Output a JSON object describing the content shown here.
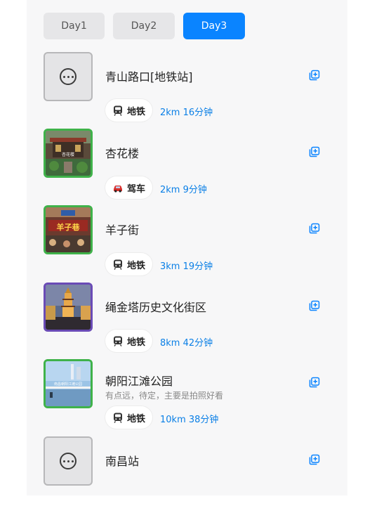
{
  "colors": {
    "accent": "#0a84ff",
    "distance_text": "#0a7fe6"
  },
  "tabs": [
    {
      "label": "Day1",
      "active": false
    },
    {
      "label": "Day2",
      "active": false
    },
    {
      "label": "Day3",
      "active": true
    }
  ],
  "stops": [
    {
      "title": "青山路口[地铁站]",
      "image": "placeholder",
      "icon": "more-dots-icon"
    },
    {
      "title": "杏花楼",
      "image": "photo",
      "image_caption": "杏花楼"
    },
    {
      "title": "羊子街",
      "image": "photo",
      "image_caption": "羊子巷"
    },
    {
      "title": "绳金塔历史文化街区",
      "image": "photo"
    },
    {
      "title": "朝阳江滩公园",
      "note": "有点远，待定，主要是拍照好看",
      "image": "photo",
      "image_caption": "南昌朝阳江滩公园"
    },
    {
      "title": "南昌站",
      "image": "placeholder",
      "icon": "more-dots-icon"
    }
  ],
  "legs": [
    {
      "mode": "地铁",
      "mode_icon": "metro-icon",
      "summary": "2km  16分钟"
    },
    {
      "mode": "驾车",
      "mode_icon": "car-icon",
      "summary": "2km  9分钟"
    },
    {
      "mode": "地铁",
      "mode_icon": "metro-icon",
      "summary": "3km  19分钟"
    },
    {
      "mode": "地铁",
      "mode_icon": "metro-icon",
      "summary": "8km  42分钟"
    },
    {
      "mode": "地铁",
      "mode_icon": "metro-icon",
      "summary": "10km  38分钟"
    }
  ]
}
